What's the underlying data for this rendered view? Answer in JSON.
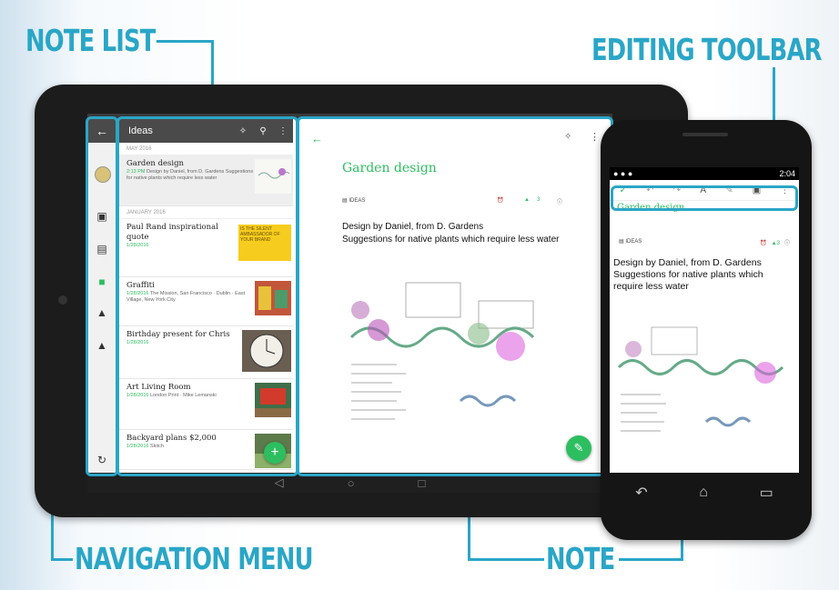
{
  "callouts": {
    "note_list": "NOTE LIST",
    "editing_toolbar": "EDITING TOOLBAR",
    "navigation_menu": "NAVIGATION MENU",
    "note": "NOTE"
  },
  "colors": {
    "accent": "#2aa6c7",
    "brand_green": "#2dbe60",
    "dark_bar": "#4a4a4a"
  },
  "nav_rail": {
    "icons": [
      "back-arrow-icon",
      "avatar",
      "shortcut-icon",
      "note-icon",
      "notebook-icon",
      "lock-icon",
      "trash-icon",
      "sync-icon"
    ]
  },
  "note_list": {
    "title": "Ideas",
    "sections": [
      {
        "label": "MAY 2016"
      },
      {
        "label": "JANUARY 2016"
      }
    ],
    "items": [
      {
        "title": "Garden design",
        "time": "2:13 PM",
        "snippet": "Design by Daniel, from D. Gardens Suggestions for native plants which require less water"
      },
      {
        "title": "Paul Rand inspirational quote",
        "time": "1/28/2016",
        "snippet": "",
        "thumb_text": "IS THE SILENT AMBASSADOR OF YOUR BRAND"
      },
      {
        "title": "Graffiti",
        "time": "1/28/2016",
        "snippet": "The Mission, San Francisco · Dublin · East Village, New York City"
      },
      {
        "title": "Birthday present for Chris",
        "time": "1/28/2016",
        "snippet": ""
      },
      {
        "title": "Art Living Room",
        "time": "1/28/2016",
        "snippet": "London Print · Mike Lemanski"
      },
      {
        "title": "Backyard plans $2,000",
        "time": "1/28/2016",
        "snippet": "Skitch"
      }
    ]
  },
  "note": {
    "title": "Garden design",
    "notebook": "IDEAS",
    "count": "3",
    "body_line1": "Design by Daniel, from D. Gardens",
    "body_line2": "Suggestions for native plants which require less water"
  },
  "phone": {
    "time": "2:04",
    "title": "Garden design",
    "notebook": "IDEAS",
    "count": "3",
    "body_line1": "Design by Daniel, from D. Gardens",
    "body_line2": "Suggestions for native plants which require less water"
  }
}
